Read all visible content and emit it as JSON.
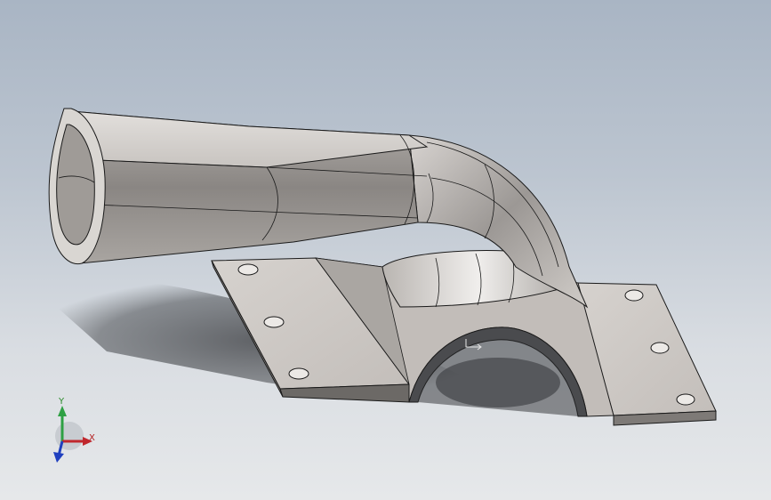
{
  "viewport": {
    "background_top": "#a9b5c4",
    "background_bottom": "#e6e8ea"
  },
  "model": {
    "part_color": "#cfcac6",
    "shade_color": "#8d8986",
    "edge_color": "#1a1a1a"
  },
  "triad": {
    "x_label": "X",
    "y_label": "Y",
    "x_color": "#c0272d",
    "y_color": "#2ea043",
    "z_color": "#1f3fbf"
  }
}
